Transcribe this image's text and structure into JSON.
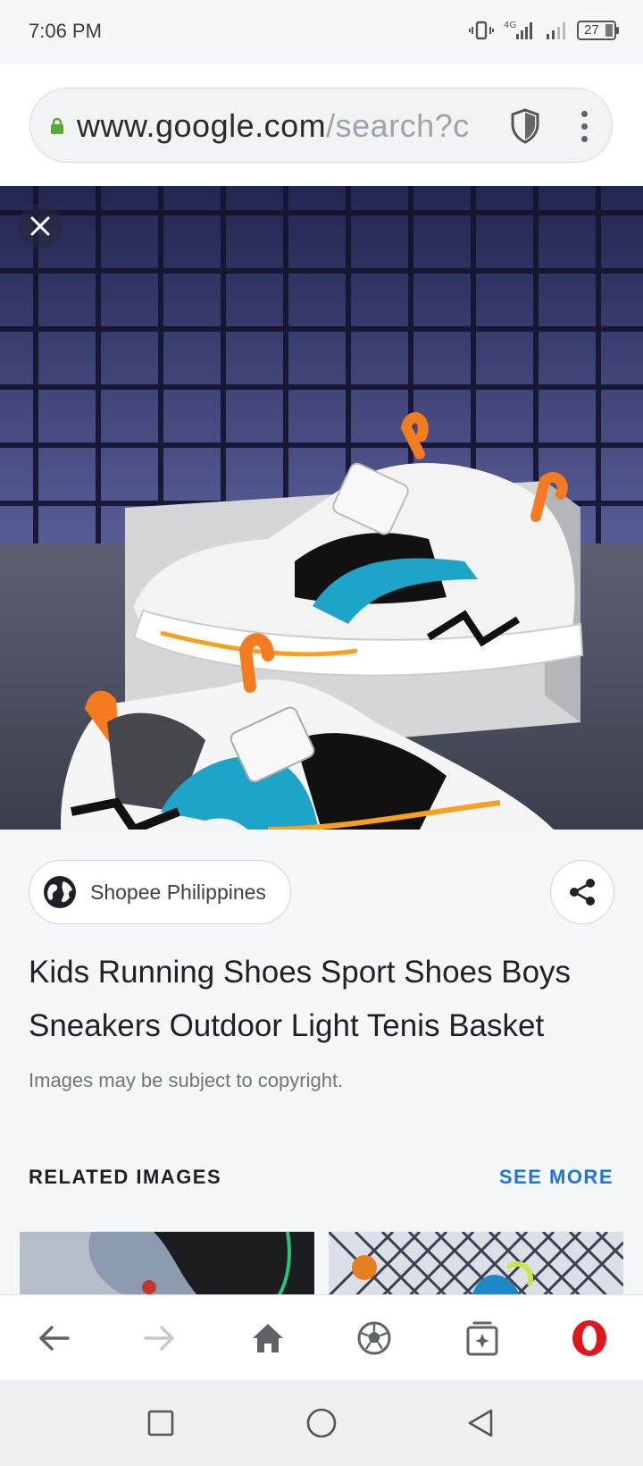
{
  "status_bar": {
    "time": "7:06 PM",
    "network": "4G",
    "battery": "27",
    "icons": [
      "vibrate-icon",
      "signal-4g-icon",
      "signal-icon",
      "battery-icon"
    ]
  },
  "url_bar": {
    "host": "www.google.com",
    "path": "/search?c",
    "icons": [
      "lock-icon",
      "shield-icon",
      "more-vert-icon"
    ]
  },
  "image_viewer": {
    "close_icon": "close-icon",
    "image_subject": "kids sneakers"
  },
  "source": {
    "name": "Shopee Philippines",
    "icon": "globe-icon",
    "share_icon": "share-icon"
  },
  "result": {
    "title": "Kids Running Shoes Sport Shoes Boys Sneakers Outdoor Light Tenis Basket",
    "copyright_note": "Images may be subject to copyright."
  },
  "related": {
    "heading": "RELATED IMAGES",
    "see_more": "SEE MORE"
  },
  "browser_nav": {
    "items": [
      "back-icon",
      "forward-icon",
      "home-icon",
      "soccer-ball-icon",
      "tabs-icon",
      "opera-icon"
    ]
  },
  "system_nav": {
    "items": [
      "recents-icon",
      "home-circle-icon",
      "back-triangle-icon"
    ]
  },
  "colors": {
    "accent": "#1a73e8",
    "lock": "#5aa934",
    "opera": "#e0161d"
  }
}
